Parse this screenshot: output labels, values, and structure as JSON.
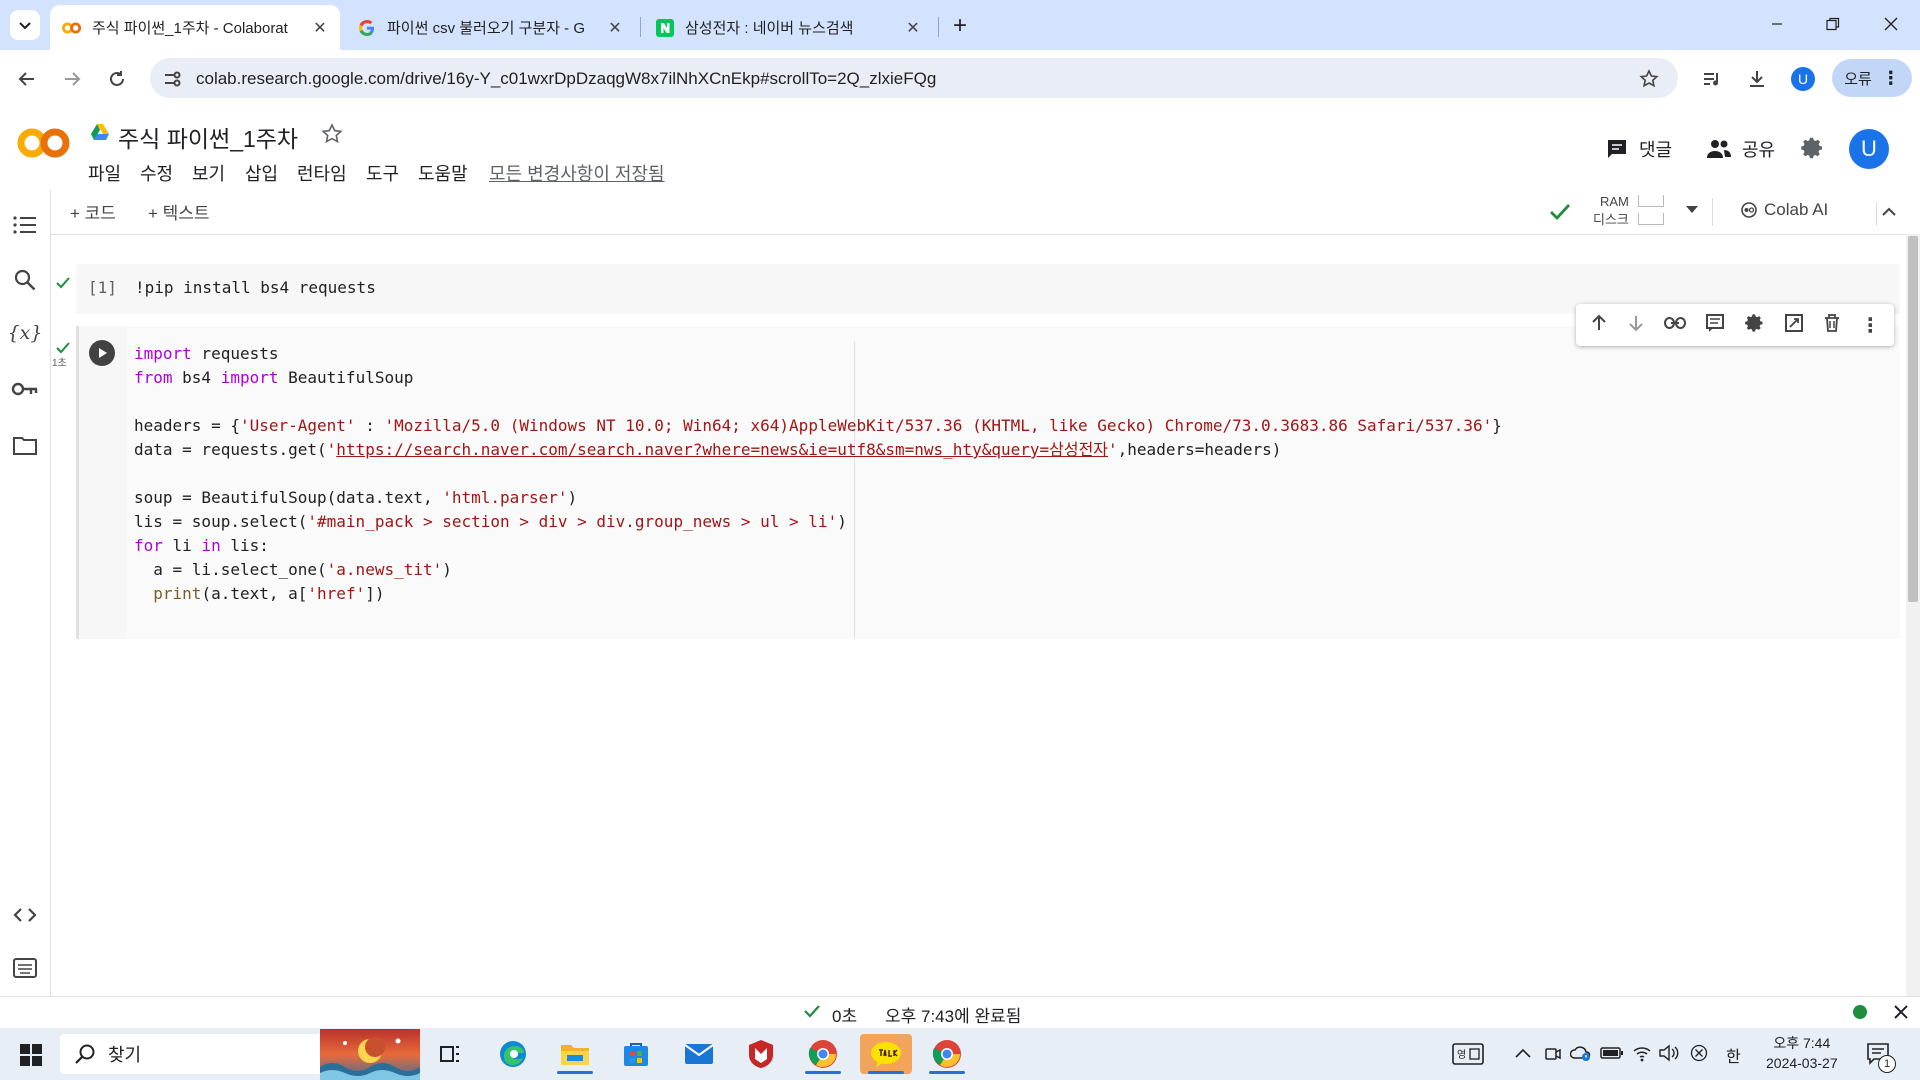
{
  "browser": {
    "tabs": [
      {
        "title": "주식 파이썬_1주차 - Colaborat",
        "icon": "colab-logo-icon",
        "active": true
      },
      {
        "title": "파이썬 csv 불러오기 구분자 - G",
        "icon": "google-g-icon",
        "active": false
      },
      {
        "title": "삼성전자 : 네이버 뉴스검색",
        "icon": "naver-n-icon",
        "active": false
      }
    ],
    "url": "colab.research.google.com/drive/16y-Y_c01wxrDpDzaqgW8x7ilNhXCnEkp#scrollTo=2Q_zlxieFQg",
    "profile_avatar": "U",
    "profile_chip_label": "오류"
  },
  "colab": {
    "notebook_title": "주식 파이썬_1주차",
    "menus": [
      "파일",
      "수정",
      "보기",
      "삽입",
      "런타임",
      "도구",
      "도움말"
    ],
    "save_status": "모든 변경사항이 저장됨",
    "comment_label": "댓글",
    "share_label": "공유",
    "user_avatar": "U",
    "add_code_label": "+ 코드",
    "add_text_label": "+ 텍스트",
    "ram_label": "RAM",
    "disk_label": "디스크",
    "colab_ai_label": "Colab AI"
  },
  "cells": [
    {
      "execution_count": "[1]",
      "code": "!pip install bs4 requests"
    },
    {
      "run_time": "1초"
    }
  ],
  "status_bar": {
    "elapsed": "0초",
    "completed": "오후 7:43에 완료됨"
  },
  "taskbar": {
    "search_placeholder": "찾기",
    "time": "오후 7:44",
    "date": "2024-03-27",
    "ime": "한",
    "notification_count": "1"
  },
  "colors": {
    "tabstrip": "#d3e3fd",
    "accent": "#1a73e8",
    "run_ok": "#1e8e3e",
    "keyword": "#af00db",
    "string": "#a31515"
  }
}
